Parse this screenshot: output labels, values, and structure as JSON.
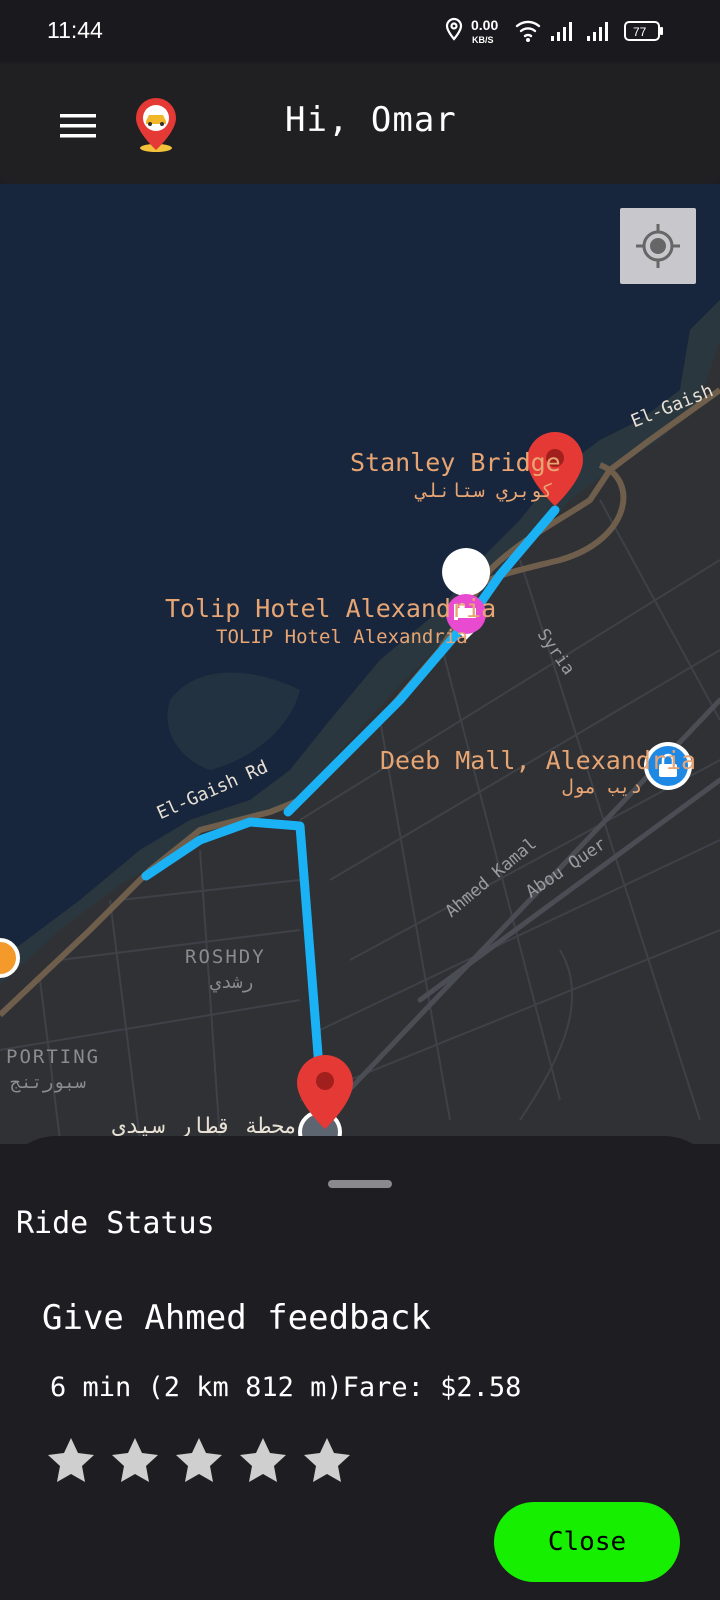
{
  "status_bar": {
    "time": "11:44",
    "net_speed_value": "0.00",
    "net_speed_unit": "KB/S",
    "battery": "77"
  },
  "app_bar": {
    "greeting": "Hi, Omar"
  },
  "map": {
    "labels": {
      "stanley_en": "Stanley Bridge",
      "stanley_ar": "كوبري ستانلي",
      "tolip_en": "Tolip Hotel Alexandria",
      "tolip_sub": "TOLIP Hotel Alexandria",
      "deeb_en": "Deeb Mall, Alexandria",
      "deeb_ar": "ديب مول",
      "syria": "Syria",
      "elgaish_rd": "El-Gaish Rd",
      "elgaish_top": "El-Gaish Rd",
      "ahmed_kamal": "Ahmed Kamal",
      "abou_quer": "Abou Quer",
      "roshdy_en": "ROSHDY",
      "roshdy_ar": "رشدي",
      "sporting_en": "PORTING",
      "sporting_ar": "سبورتنج",
      "station_ar": "محطة قطار سيدي"
    }
  },
  "sheet": {
    "title": "Ride Status",
    "feedback_title": "Give Ahmed feedback",
    "trip_info": "6 min (2 km 812 m)Fare: $2.58",
    "rating": 0,
    "rating_max": 5,
    "close_label": "Close"
  },
  "colors": {
    "route": "#1ab2f5",
    "water": "#17263c",
    "land": "#2f3135",
    "road_major": "#6f5e4b",
    "label_orange": "#e8a574",
    "pin_red": "#e53935",
    "close_green": "#16f000",
    "star_gray": "#cfcfcf"
  }
}
